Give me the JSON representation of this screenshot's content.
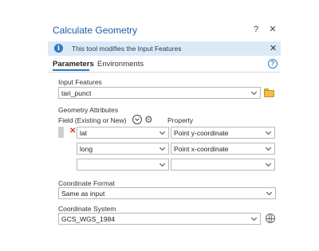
{
  "window": {
    "title": "Calculate Geometry",
    "help_glyph": "?",
    "close_glyph": "✕"
  },
  "banner": {
    "icon": "info-icon",
    "icon_glyph": "i",
    "text": "This tool modifies the Input Features",
    "close_glyph": "✕"
  },
  "tabs": {
    "parameters": "Parameters",
    "environments": "Environments",
    "help_glyph": "?"
  },
  "input_features": {
    "label": "Input Features",
    "value": "tari_punct"
  },
  "geometry_attributes": {
    "label": "Geometry Attributes",
    "field_header": "Field (Existing or New)",
    "property_header": "Property",
    "remove_glyph": "✕",
    "rows": [
      {
        "field": "lat",
        "property": "Point y-coordinate"
      },
      {
        "field": "long",
        "property": "Point x-coordinate"
      },
      {
        "field": "",
        "property": ""
      }
    ]
  },
  "coordinate_format": {
    "label": "Coordinate Format",
    "value": "Same as input"
  },
  "coordinate_system": {
    "label": "Coordinate System",
    "value": "GCS_WGS_1984"
  },
  "colors": {
    "title": "#1a5fa8",
    "banner_bg": "#dbeaf6",
    "accent": "#2f79c0",
    "delete": "#d2372c",
    "folder": "#f0be45"
  }
}
